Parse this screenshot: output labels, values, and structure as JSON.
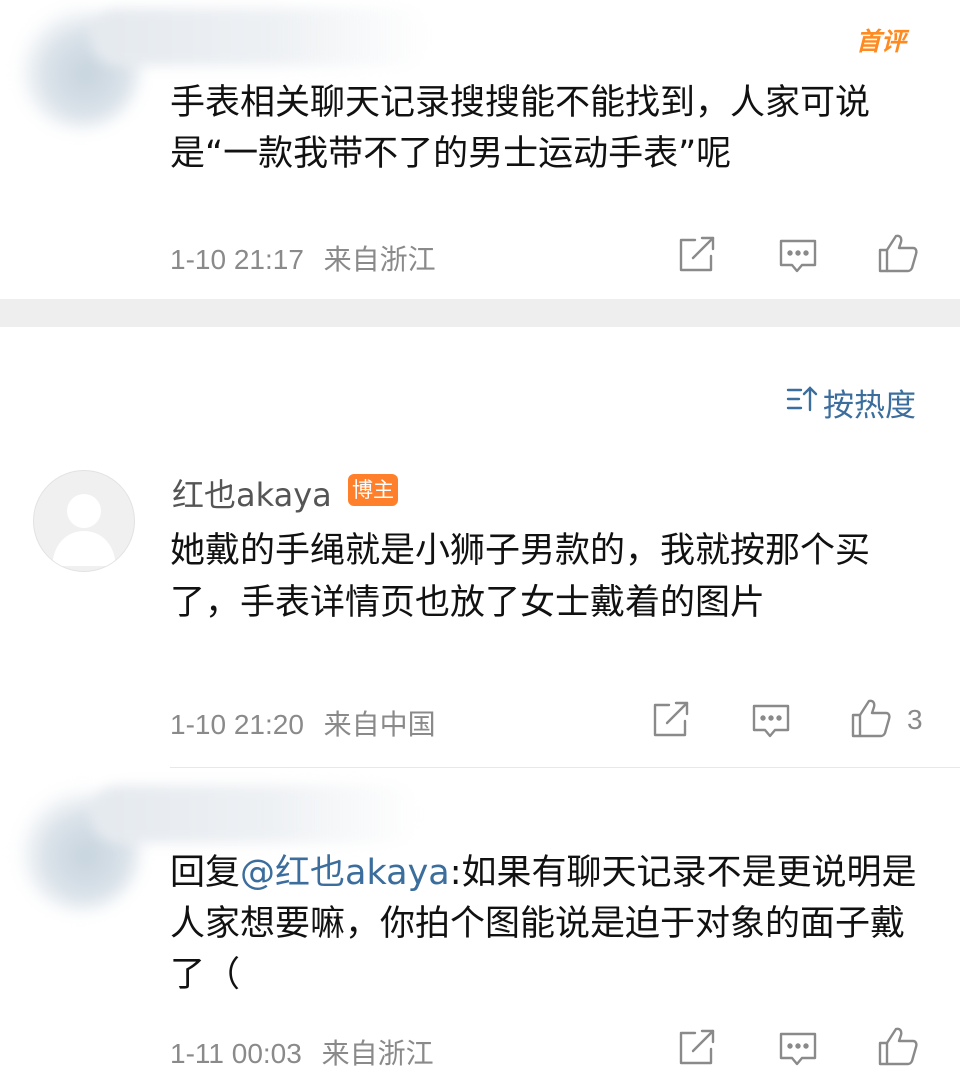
{
  "comments": [
    {
      "hot_label": "首评",
      "content": "手表相关聊天记录搜搜能不能找到，人家可说是“一款我带不了的男士运动手表”呢",
      "time": "1-10 21:17",
      "location": "来自浙江"
    },
    {
      "username": "红也akaya",
      "badge": "博主",
      "content": "她戴的手绳就是小狮子男款的，我就按那个买了，手表详情页也放了女士戴着的图片",
      "time": "1-10 21:20",
      "location": "来自中国",
      "likes": "3"
    },
    {
      "reply_prefix": "回复",
      "reply_target": "@红也akaya",
      "content": ":如果有聊天记录不是更说明是人家想要嘛，你拍个图能说是迫于对象的面子戴了（",
      "time": "1-11 00:03",
      "location": "来自浙江"
    }
  ],
  "sort": {
    "label": "按热度",
    "icon": "sort-icon"
  },
  "icons": {
    "share": "share-icon",
    "comment": "comment-icon",
    "like": "like-icon"
  },
  "colors": {
    "link": "#3b6e9c",
    "badge": "#ff7f2a",
    "hot": "#ff8a1f",
    "meta": "#8a8a8a"
  }
}
